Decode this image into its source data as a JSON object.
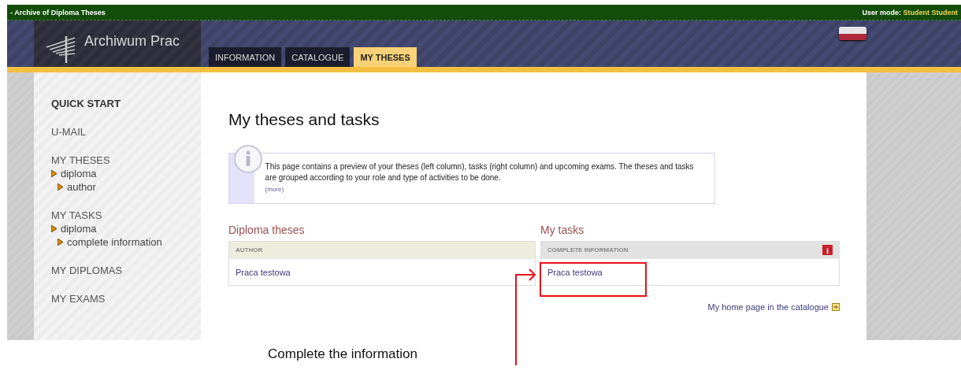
{
  "top_bar": {
    "title": "- Archive of Diploma Theses",
    "user_mode_label": "User mode:",
    "user_name": "Student Student"
  },
  "header": {
    "logo_text": "Archiwum Prac",
    "tabs": [
      {
        "label": "INFORMATION",
        "selected": false
      },
      {
        "label": "CATALOGUE",
        "selected": false
      },
      {
        "label": "MY THESES",
        "selected": true
      }
    ]
  },
  "sidebar": {
    "items": [
      {
        "label": "QUICK START",
        "kind": "heading"
      },
      {
        "label": "U-MAIL",
        "kind": "link"
      },
      {
        "label": "MY THESES",
        "kind": "link",
        "children": [
          {
            "label": "diploma",
            "children": [
              {
                "label": "author"
              }
            ]
          }
        ]
      },
      {
        "label": "MY TASKS",
        "kind": "link",
        "children": [
          {
            "label": "diploma",
            "children": [
              {
                "label": "complete information"
              }
            ]
          }
        ]
      },
      {
        "label": "MY DIPLOMAS",
        "kind": "link"
      },
      {
        "label": "MY EXAMS",
        "kind": "link"
      }
    ]
  },
  "main": {
    "title": "My theses and tasks",
    "info": {
      "text": "This page contains a preview of your theses (left column), tasks (right column) and upcoming exams. The theses and tasks are grouped according to your role and type of activities to be done.",
      "more": "(more)"
    },
    "columns": [
      {
        "heading": "Diploma theses",
        "group": {
          "label": "AUTHOR",
          "kind": "role",
          "items": [
            "Praca testowa"
          ]
        }
      },
      {
        "heading": "My tasks",
        "group": {
          "label": "COMPLETE INFORMATION",
          "kind": "task",
          "badge": "i",
          "items": [
            "Praca testowa"
          ]
        },
        "link": "My home page in the catalogue"
      }
    ]
  },
  "annotation": {
    "text": "Complete the information"
  }
}
